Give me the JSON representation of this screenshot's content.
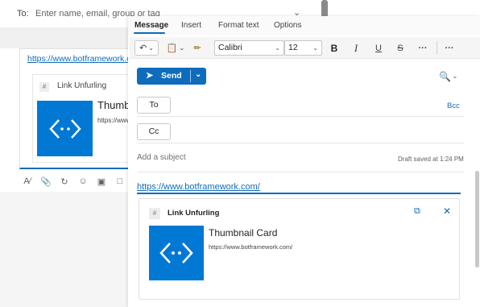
{
  "background": {
    "to_label": "To:",
    "to_placeholder": "Enter name, email, group or tag",
    "link": "https://www.botframework.com/",
    "card": {
      "header": "Link Unfurling",
      "title": "Thumbnail Card",
      "url": "https://www.botframework.com/"
    },
    "toolbar": [
      "format-icon",
      "attach-icon",
      "loop-icon",
      "emoji-icon",
      "gif-icon",
      "sticker-icon"
    ]
  },
  "window": {
    "tabs": [
      {
        "label": "Message",
        "active": true
      },
      {
        "label": "Insert",
        "active": false
      },
      {
        "label": "Format text",
        "active": false
      },
      {
        "label": "Options",
        "active": false
      }
    ],
    "ribbon": {
      "font": "Calibri",
      "size": "12",
      "bold": "B",
      "italic": "I",
      "underline": "U",
      "strike": "S",
      "more": "···",
      "overflow": "···"
    },
    "send_label": "Send",
    "to_button": "To",
    "cc_button": "Cc",
    "bcc_link": "Bcc",
    "subject_placeholder": "Add a subject",
    "draft_status": "Draft saved at 1:24 PM",
    "body_link": "https://www.botframework.com/",
    "card": {
      "header": "Link Unfurling",
      "title": "Thumbnail Card",
      "url": "https://www.botframework.com/",
      "thumb_icon": "code-icon"
    },
    "colors": {
      "accent": "#0f6cbd",
      "thumb": "#0078d4"
    }
  }
}
